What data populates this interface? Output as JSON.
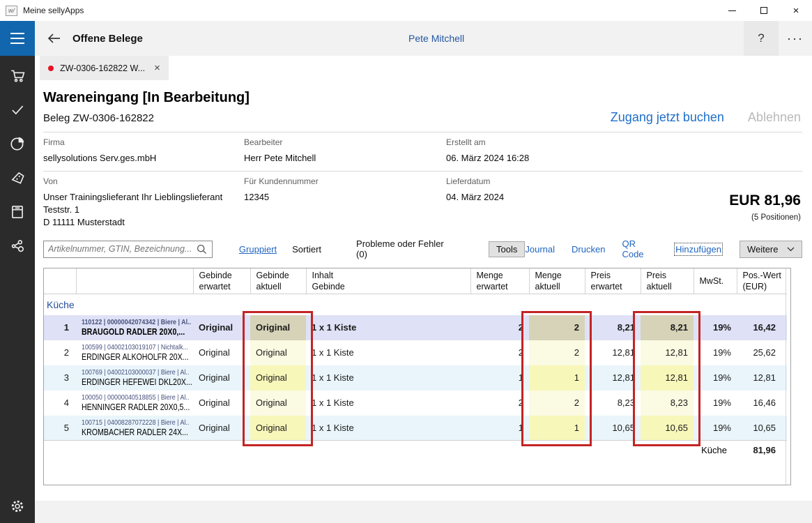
{
  "window": {
    "title": "Meine sellyApps"
  },
  "appbar": {
    "title": "Offene Belege",
    "user": "Pete Mitchell"
  },
  "tab": {
    "label": "ZW-0306-162822 W..."
  },
  "doc": {
    "title": "Wareneingang [In Bearbeitung]",
    "subtitle": "Beleg ZW-0306-162822",
    "primary_action": "Zugang jetzt buchen",
    "secondary_action": "Ablehnen",
    "total": "EUR 81,96",
    "total_note": "(5 Positionen)",
    "fields": {
      "firma": {
        "label": "Firma",
        "value": "sellysolutions Serv.ges.mbH"
      },
      "bearbeiter": {
        "label": "Bearbeiter",
        "value": "Herr Pete Mitchell"
      },
      "erstellt": {
        "label": "Erstellt am",
        "value": "06. März 2024 16:28"
      },
      "von": {
        "label": "Von",
        "line1": "Unser Trainingslieferant Ihr Lieblingslieferant",
        "line2": "Teststr. 1",
        "line3": "D 11111 Musterstadt"
      },
      "kundennummer": {
        "label": "Für Kundennummer",
        "value": "12345"
      },
      "lieferdatum": {
        "label": "Lieferdatum",
        "value": "04. März 2024"
      }
    }
  },
  "toolbar": {
    "search_placeholder": "Artikelnummer, GTIN, Bezeichnung...",
    "gruppiert": "Gruppiert",
    "sortiert": "Sortiert",
    "probleme": "Probleme oder Fehler (0)",
    "tools": "Tools",
    "journal": "Journal",
    "drucken": "Drucken",
    "qr": "QR Code",
    "hinzufuegen": "Hinzufügen",
    "weitere": "Weitere"
  },
  "table": {
    "headers": [
      {
        "l1": "Gebinde",
        "l2": "erwartet"
      },
      {
        "l1": "Gebinde",
        "l2": "aktuell"
      },
      {
        "l1": "Inhalt",
        "l2": "Gebinde"
      },
      {
        "l1": "Menge",
        "l2": "erwartet"
      },
      {
        "l1": "Menge",
        "l2": "aktuell"
      },
      {
        "l1": "Preis",
        "l2": "erwartet"
      },
      {
        "l1": "Preis",
        "l2": "aktuell"
      },
      {
        "l1": "MwSt.",
        "l2": ""
      },
      {
        "l1": "Pos.-Wert",
        "l2": "(EUR)"
      }
    ],
    "group": "Küche",
    "rows": [
      {
        "num": "1",
        "code": "110122 | 00000042074342 | Biere | Al..",
        "name": "BRAUGOLD RADLER 20X0,...",
        "gebinde_erwartet": "Original",
        "gebinde_aktuell": "Original",
        "inhalt": "1 x 1 Kiste",
        "menge_erwartet": "2",
        "menge_aktuell": "2",
        "preis_erwartet": "8,21",
        "preis_aktuell": "8,21",
        "mwst": "19%",
        "pos_wert": "16,42"
      },
      {
        "num": "2",
        "code": "100599 | 04002103019107 | Nichtalk...",
        "name": "ERDINGER ALKOHOLFR 20X...",
        "gebinde_erwartet": "Original",
        "gebinde_aktuell": "Original",
        "inhalt": "1 x 1 Kiste",
        "menge_erwartet": "2",
        "menge_aktuell": "2",
        "preis_erwartet": "12,81",
        "preis_aktuell": "12,81",
        "mwst": "19%",
        "pos_wert": "25,62"
      },
      {
        "num": "3",
        "code": "100769 | 04002103000037 | Biere | Al..",
        "name": "ERDINGER HEFEWEI DKL20X...",
        "gebinde_erwartet": "Original",
        "gebinde_aktuell": "Original",
        "inhalt": "1 x 1 Kiste",
        "menge_erwartet": "1",
        "menge_aktuell": "1",
        "preis_erwartet": "12,81",
        "preis_aktuell": "12,81",
        "mwst": "19%",
        "pos_wert": "12,81"
      },
      {
        "num": "4",
        "code": "100050 | 00000040518855 | Biere | Al..",
        "name": "HENNINGER RADLER 20X0,5...",
        "gebinde_erwartet": "Original",
        "gebinde_aktuell": "Original",
        "inhalt": "1 x 1 Kiste",
        "menge_erwartet": "2",
        "menge_aktuell": "2",
        "preis_erwartet": "8,23",
        "preis_aktuell": "8,23",
        "mwst": "19%",
        "pos_wert": "16,46"
      },
      {
        "num": "5",
        "code": "100715 | 04008287072228 | Biere | Al..",
        "name": "KROMBACHER RADLER 24X...",
        "gebinde_erwartet": "Original",
        "gebinde_aktuell": "Original",
        "inhalt": "1 x 1 Kiste",
        "menge_erwartet": "1",
        "menge_aktuell": "1",
        "preis_erwartet": "10,65",
        "preis_aktuell": "10,65",
        "mwst": "19%",
        "pos_wert": "10,65"
      }
    ],
    "footer": {
      "label": "Küche",
      "value": "81,96"
    }
  },
  "colors": {
    "accent_blue": "#2065c0",
    "sidebar_dark": "#2b2b2b",
    "hamburger_blue": "#1266ad",
    "highlight_red": "#c32424",
    "row_selected": "#dfe2f6",
    "row_alt": "#e9f5fb",
    "cell_tan": "#d6d3b8",
    "cell_yellow": "#f8f7ba",
    "cell_yellow_light": "#fbfae2",
    "tab_dot_red": "#e81123"
  }
}
